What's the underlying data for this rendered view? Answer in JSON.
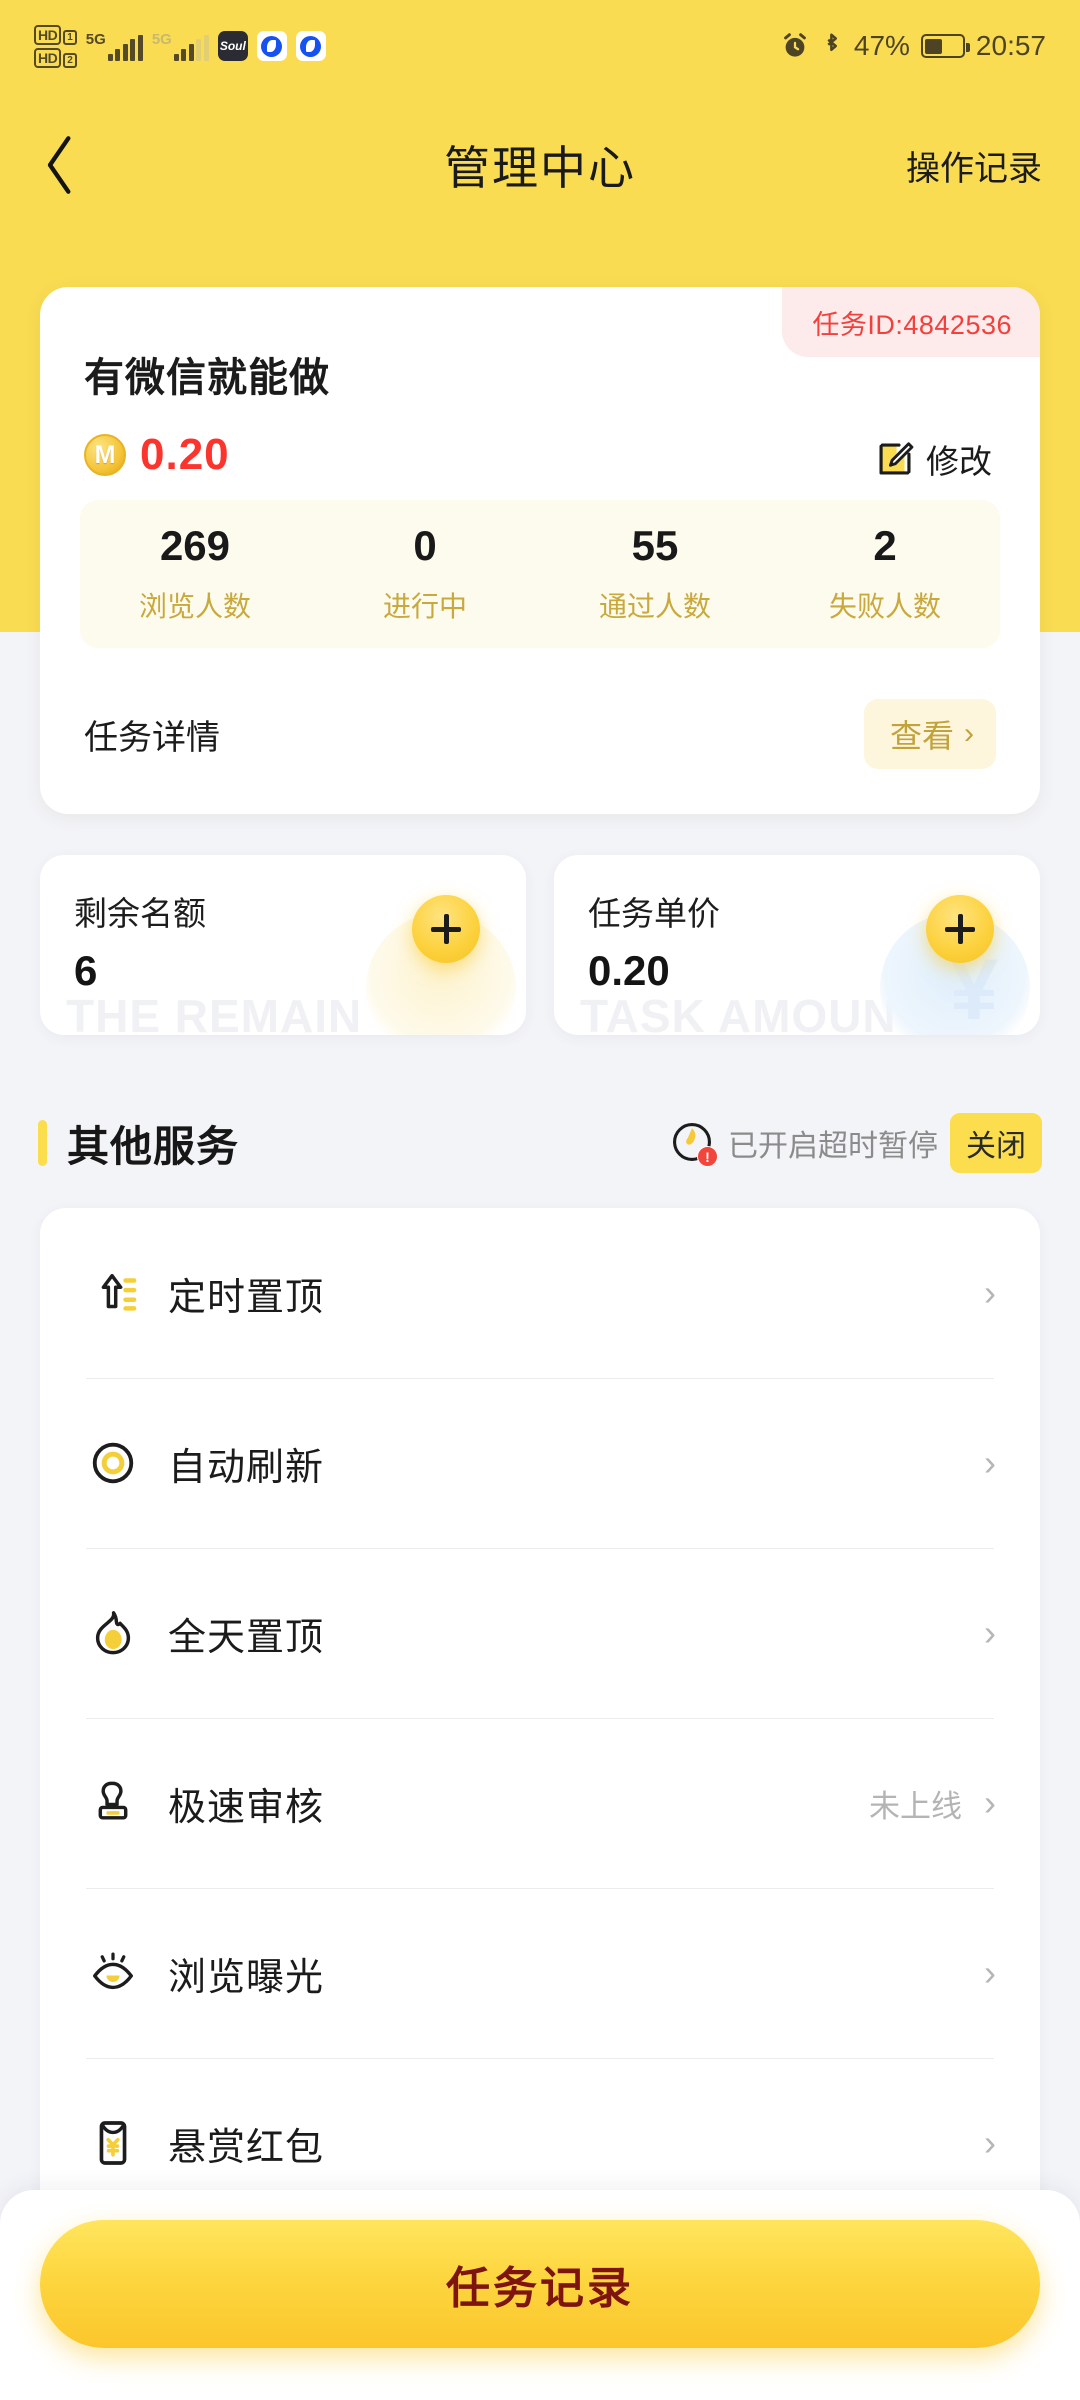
{
  "status_bar": {
    "hd1": "HD",
    "hd1_num": "1",
    "hd2": "HD",
    "hd2_num": "2",
    "net1": "5G",
    "net2": "5G",
    "app1": "Soul",
    "battery_percent": "47%",
    "time": "20:57"
  },
  "nav": {
    "back_icon": "chevron-left-icon",
    "title": "管理中心",
    "right_link": "操作记录"
  },
  "task_card": {
    "task_id_label": "任务ID:4842536",
    "title": "有微信就能做",
    "coin_symbol": "M",
    "price": "0.20",
    "edit_label": "修改",
    "stats": [
      {
        "value": "269",
        "label": "浏览人数"
      },
      {
        "value": "0",
        "label": "进行中"
      },
      {
        "value": "55",
        "label": "通过人数"
      },
      {
        "value": "2",
        "label": "失败人数"
      }
    ],
    "detail_label": "任务详情",
    "detail_action": "查看",
    "detail_chevron": "›"
  },
  "mini_cards": [
    {
      "label": "剩余名额",
      "value": "6",
      "watermark": "THE REMAIN",
      "add_icon": "plus-icon"
    },
    {
      "label": "任务单价",
      "value": "0.20",
      "watermark": "TASK AMOUN",
      "add_icon": "plus-icon"
    }
  ],
  "section": {
    "title": "其他服务",
    "note": "已开启超时暂停",
    "close_label": "关闭",
    "badge": "!"
  },
  "services": [
    {
      "label": "定时置顶",
      "icon": "arrow-up-lines-icon",
      "note": ""
    },
    {
      "label": "自动刷新",
      "icon": "refresh-target-icon",
      "note": ""
    },
    {
      "label": "全天置顶",
      "icon": "flame-icon",
      "note": ""
    },
    {
      "label": "极速审核",
      "icon": "stamp-icon",
      "note": "未上线"
    },
    {
      "label": "浏览曝光",
      "icon": "eye-icon",
      "note": ""
    },
    {
      "label": "悬赏红包",
      "icon": "red-packet-icon",
      "note": ""
    }
  ],
  "bottom": {
    "record_label": "任务记录"
  },
  "colors": {
    "brand_yellow": "#f9dc52",
    "accent_yellow": "#fbdd4e",
    "price_red": "#fb342e",
    "id_red": "#f2403c",
    "stat_label": "#c9a93c",
    "page_bg": "#f3f4f8",
    "button_text": "#7d1410"
  },
  "chevron": "›"
}
